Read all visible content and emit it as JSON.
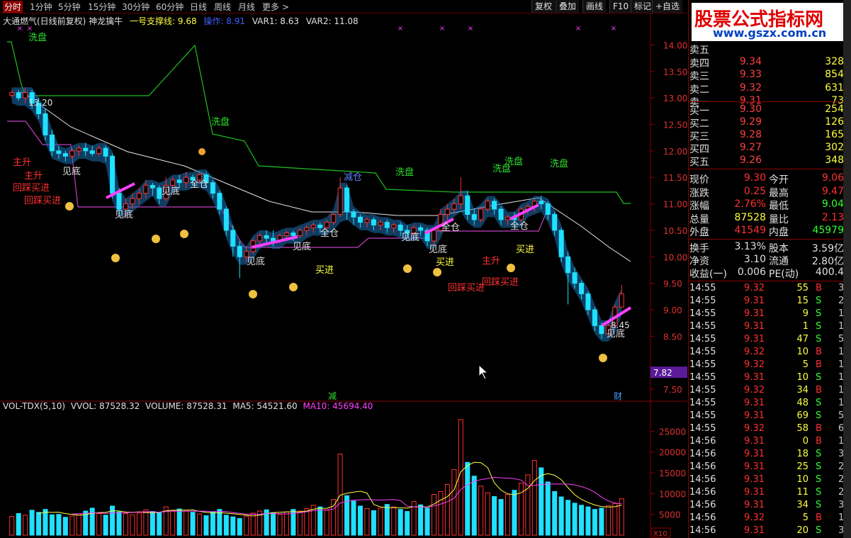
{
  "period_bar": [
    "分时",
    "1分钟",
    "5分钟",
    "15分钟",
    "30分钟",
    "60分钟",
    "日线",
    "周线",
    "月线",
    "更多 >"
  ],
  "toolbar": [
    "复权",
    "叠加",
    "画线",
    "F10",
    "标记",
    "+自选"
  ],
  "indicator_header": {
    "title": "大通燃气(日线前复权) 神龙擒牛",
    "support": "一号支撑线: 9.68",
    "op": "操作: 8.91",
    "var1": "VAR1: 8.63",
    "var2": "VAR2: 11.08"
  },
  "price_axis": [
    "14.00",
    "13.50",
    "13.00",
    "12.50",
    "12.00",
    "11.50",
    "11.00",
    "10.50",
    "10.00",
    "9.50",
    "9.00",
    "8.50",
    "7.82",
    "7.50"
  ],
  "volume_axis": [
    "25000",
    "20000",
    "15000",
    "10000",
    "5000",
    "X10"
  ],
  "volume_header": {
    "name": "VOL-TDX(5,10)",
    "vvol": "VVOL: 87528.32",
    "volume": "VOLUME: 87528.31",
    "ma5": "MA5: 54521.60",
    "ma10": "MA10: 45694.40"
  },
  "chart_labels": {
    "high": "13.20",
    "low": "8.45",
    "xipan": "洗盘",
    "jiandi": "见底",
    "quancang": "全仓",
    "jiancang": "减仓",
    "maijin": "买进",
    "zhusheng": "主升",
    "huicai": "回踩买进",
    "jian": "减",
    "cai": "财"
  },
  "logo": {
    "title": "股票公式指标网",
    "url": "www.gszx.com.cn"
  },
  "order_book": {
    "asks": [
      {
        "label": "卖五",
        "price": "",
        "vol": ""
      },
      {
        "label": "卖四",
        "price": "9.34",
        "vol": "328"
      },
      {
        "label": "卖三",
        "price": "9.33",
        "vol": "854"
      },
      {
        "label": "卖二",
        "price": "9.32",
        "vol": "631"
      },
      {
        "label": "卖一",
        "price": "9.31",
        "vol": "73"
      }
    ],
    "bids": [
      {
        "label": "买一",
        "price": "9.30",
        "vol": "254"
      },
      {
        "label": "买二",
        "price": "9.29",
        "vol": "126"
      },
      {
        "label": "买三",
        "price": "9.28",
        "vol": "165"
      },
      {
        "label": "买四",
        "price": "9.27",
        "vol": "302"
      },
      {
        "label": "买五",
        "price": "9.26",
        "vol": "348"
      }
    ]
  },
  "quote": [
    {
      "l1": "现价",
      "v1": "9.30",
      "c1": "red",
      "l2": "今开",
      "v2": "9.06",
      "c2": "red"
    },
    {
      "l1": "涨跌",
      "v1": "0.25",
      "c1": "red",
      "l2": "最高",
      "v2": "9.47",
      "c2": "red"
    },
    {
      "l1": "涨幅",
      "v1": "2.76%",
      "c1": "red",
      "l2": "最低",
      "v2": "9.04",
      "c2": "grn"
    },
    {
      "l1": "总量",
      "v1": "87528",
      "c1": "yel",
      "l2": "量比",
      "v2": "2.13",
      "c2": "red"
    },
    {
      "l1": "外盘",
      "v1": "41549",
      "c1": "red",
      "l2": "内盘",
      "v2": "45979",
      "c2": "grn"
    }
  ],
  "quote2": [
    {
      "l1": "换手",
      "v1": "3.13%",
      "c1": "wht",
      "l2": "股本",
      "v2": "3.59亿",
      "c2": "wht"
    },
    {
      "l1": "净资",
      "v1": "3.10",
      "c1": "wht",
      "l2": "流通",
      "v2": "2.80亿",
      "c2": "wht"
    },
    {
      "l1": "收益(一)",
      "v1": "0.006",
      "c1": "wht",
      "l2": "PE(动)",
      "v2": "400.4",
      "c2": "wht"
    }
  ],
  "ticks": [
    {
      "t": "14:55",
      "p": "9.32",
      "v": "55",
      "bs": "B",
      "n": "3"
    },
    {
      "t": "14:55",
      "p": "9.31",
      "v": "15",
      "bs": "S",
      "n": "2"
    },
    {
      "t": "14:55",
      "p": "9.31",
      "v": "9",
      "bs": "S",
      "n": "1"
    },
    {
      "t": "14:55",
      "p": "9.31",
      "v": "1",
      "bs": "S",
      "n": "1"
    },
    {
      "t": "14:55",
      "p": "9.31",
      "v": "47",
      "bs": "S",
      "n": "5"
    },
    {
      "t": "14:55",
      "p": "9.32",
      "v": "10",
      "bs": "B",
      "n": "1"
    },
    {
      "t": "14:55",
      "p": "9.32",
      "v": "5",
      "bs": "B",
      "n": "1"
    },
    {
      "t": "14:55",
      "p": "9.31",
      "v": "10",
      "bs": "S",
      "n": "1"
    },
    {
      "t": "14:55",
      "p": "9.32",
      "v": "34",
      "bs": "B",
      "n": "1"
    },
    {
      "t": "14:55",
      "p": "9.31",
      "v": "48",
      "bs": "S",
      "n": "1"
    },
    {
      "t": "14:55",
      "p": "9.31",
      "v": "69",
      "bs": "S",
      "n": "5"
    },
    {
      "t": "14:55",
      "p": "9.32",
      "v": "58",
      "bs": "B",
      "n": "6"
    },
    {
      "t": "14:56",
      "p": "9.31",
      "v": "0",
      "bs": "B",
      "n": "1"
    },
    {
      "t": "14:56",
      "p": "9.31",
      "v": "18",
      "bs": "S",
      "n": "3"
    },
    {
      "t": "14:56",
      "p": "9.31",
      "v": "25",
      "bs": "S",
      "n": "2"
    },
    {
      "t": "14:56",
      "p": "9.31",
      "v": "10",
      "bs": "S",
      "n": "2"
    },
    {
      "t": "14:56",
      "p": "9.31",
      "v": "11",
      "bs": "S",
      "n": "2"
    },
    {
      "t": "14:56",
      "p": "9.31",
      "v": "34",
      "bs": "S",
      "n": "3"
    },
    {
      "t": "14:56",
      "p": "9.32",
      "v": "5",
      "bs": "B",
      "n": "1"
    },
    {
      "t": "14:56",
      "p": "9.31",
      "v": "20",
      "bs": "S",
      "n": "3"
    }
  ],
  "chart_data": {
    "type": "candlestick",
    "price_ylim": [
      7.3,
      14.3
    ],
    "volume_ylim": [
      0,
      30000
    ],
    "candles": [
      [
        13.05,
        13.1,
        13.0,
        13.15
      ],
      [
        13.1,
        13.0,
        12.95,
        13.15
      ],
      [
        13.0,
        13.1,
        12.9,
        13.2
      ],
      [
        13.1,
        12.9,
        12.8,
        13.15
      ],
      [
        12.9,
        12.7,
        12.6,
        13.0
      ],
      [
        12.7,
        12.3,
        12.2,
        12.8
      ],
      [
        12.3,
        12.0,
        11.9,
        12.4
      ],
      [
        12.0,
        11.95,
        11.85,
        12.1
      ],
      [
        11.95,
        11.9,
        11.8,
        12.0
      ],
      [
        11.9,
        12.0,
        11.85,
        12.05
      ],
      [
        12.0,
        12.05,
        11.9,
        12.1
      ],
      [
        12.05,
        12.0,
        11.9,
        12.15
      ],
      [
        12.0,
        11.95,
        11.9,
        12.1
      ],
      [
        11.95,
        12.05,
        11.9,
        12.1
      ],
      [
        12.05,
        11.9,
        11.8,
        12.1
      ],
      [
        11.9,
        11.2,
        11.1,
        11.95
      ],
      [
        11.2,
        10.9,
        10.8,
        11.3
      ],
      [
        10.9,
        11.0,
        10.75,
        11.1
      ],
      [
        11.0,
        11.1,
        10.9,
        11.2
      ],
      [
        11.1,
        11.2,
        11.0,
        11.3
      ],
      [
        11.2,
        11.35,
        11.1,
        11.45
      ],
      [
        11.35,
        11.3,
        11.15,
        11.4
      ],
      [
        11.3,
        11.1,
        11.0,
        11.35
      ],
      [
        11.1,
        11.35,
        11.05,
        11.5
      ],
      [
        11.35,
        11.45,
        11.3,
        11.5
      ],
      [
        11.45,
        11.4,
        11.3,
        11.55
      ],
      [
        11.4,
        11.5,
        11.3,
        11.6
      ],
      [
        11.5,
        11.45,
        11.35,
        11.55
      ],
      [
        11.45,
        11.55,
        11.4,
        11.6
      ],
      [
        11.55,
        11.4,
        11.3,
        11.6
      ],
      [
        11.4,
        11.2,
        11.1,
        11.45
      ],
      [
        11.2,
        10.9,
        10.8,
        11.25
      ],
      [
        10.9,
        10.5,
        10.4,
        10.95
      ],
      [
        10.5,
        10.2,
        10.0,
        10.6
      ],
      [
        10.2,
        10.0,
        9.6,
        10.3
      ],
      [
        10.0,
        10.1,
        9.9,
        10.2
      ],
      [
        10.1,
        10.3,
        10.05,
        10.35
      ],
      [
        10.3,
        10.4,
        10.2,
        10.45
      ],
      [
        10.4,
        10.35,
        10.25,
        10.5
      ],
      [
        10.35,
        10.3,
        10.2,
        10.5
      ],
      [
        10.3,
        10.4,
        10.25,
        10.45
      ],
      [
        10.4,
        10.45,
        10.3,
        10.5
      ],
      [
        10.45,
        10.4,
        10.3,
        10.5
      ],
      [
        10.4,
        10.5,
        10.35,
        10.55
      ],
      [
        10.5,
        10.55,
        10.4,
        10.6
      ],
      [
        10.55,
        10.6,
        10.45,
        10.65
      ],
      [
        10.6,
        10.55,
        10.45,
        10.65
      ],
      [
        10.55,
        10.65,
        10.5,
        10.7
      ],
      [
        10.65,
        10.8,
        10.6,
        10.85
      ],
      [
        10.8,
        11.3,
        10.75,
        11.5
      ],
      [
        11.3,
        10.85,
        10.7,
        11.35
      ],
      [
        10.85,
        10.75,
        10.6,
        10.9
      ],
      [
        10.75,
        10.65,
        10.55,
        10.8
      ],
      [
        10.65,
        10.7,
        10.55,
        10.75
      ],
      [
        10.7,
        10.6,
        10.5,
        10.75
      ],
      [
        10.6,
        10.65,
        10.5,
        10.7
      ],
      [
        10.65,
        10.55,
        10.45,
        10.7
      ],
      [
        10.55,
        10.6,
        10.45,
        10.65
      ],
      [
        10.6,
        10.5,
        10.4,
        10.65
      ],
      [
        10.5,
        10.45,
        10.35,
        10.6
      ],
      [
        10.45,
        10.55,
        10.4,
        10.6
      ],
      [
        10.55,
        10.5,
        10.4,
        10.6
      ],
      [
        10.5,
        10.3,
        10.2,
        10.55
      ],
      [
        10.3,
        10.5,
        10.2,
        10.55
      ],
      [
        10.5,
        10.8,
        10.45,
        10.9
      ],
      [
        10.8,
        10.9,
        10.7,
        11.0
      ],
      [
        10.9,
        11.0,
        10.8,
        11.1
      ],
      [
        11.0,
        11.15,
        10.9,
        11.5
      ],
      [
        11.15,
        10.8,
        10.7,
        11.25
      ],
      [
        10.8,
        10.7,
        10.6,
        10.9
      ],
      [
        10.7,
        10.9,
        10.65,
        10.95
      ],
      [
        10.9,
        11.05,
        10.85,
        11.1
      ],
      [
        11.05,
        10.9,
        10.8,
        11.1
      ],
      [
        10.9,
        10.7,
        10.6,
        10.95
      ],
      [
        10.7,
        10.75,
        10.6,
        10.8
      ],
      [
        10.75,
        10.7,
        10.6,
        10.85
      ],
      [
        10.7,
        10.9,
        10.65,
        10.95
      ],
      [
        10.9,
        10.95,
        10.8,
        11.0
      ],
      [
        10.95,
        11.05,
        10.85,
        11.1
      ],
      [
        11.05,
        11.0,
        10.9,
        11.15
      ],
      [
        11.0,
        10.8,
        10.7,
        11.05
      ],
      [
        10.8,
        10.5,
        10.4,
        10.85
      ],
      [
        10.5,
        10.0,
        9.9,
        10.55
      ],
      [
        10.0,
        9.7,
        9.1,
        10.1
      ],
      [
        9.7,
        9.5,
        9.4,
        9.8
      ],
      [
        9.5,
        9.3,
        9.2,
        9.55
      ],
      [
        9.3,
        9.0,
        8.9,
        9.35
      ],
      [
        9.0,
        8.7,
        8.6,
        9.05
      ],
      [
        8.7,
        8.55,
        8.45,
        8.75
      ],
      [
        8.55,
        8.7,
        8.5,
        8.75
      ],
      [
        8.7,
        9.05,
        8.65,
        9.1
      ],
      [
        9.05,
        9.3,
        9.04,
        9.47
      ]
    ],
    "volumes": [
      4500,
      5200,
      4800,
      6000,
      5500,
      6200,
      4900,
      5000,
      4300,
      4600,
      5100,
      5800,
      6500,
      5200,
      4800,
      7000,
      5600,
      5200,
      4900,
      5300,
      6100,
      5700,
      5400,
      6800,
      5900,
      6300,
      5800,
      5500,
      5100,
      4700,
      5600,
      6200,
      4800,
      4400,
      4000,
      4600,
      5300,
      5800,
      6100,
      5400,
      5000,
      5600,
      6200,
      5800,
      6400,
      7200,
      6800,
      6000,
      8600,
      19500,
      9500,
      8200,
      7000,
      6400,
      5900,
      6500,
      7400,
      6800,
      6200,
      5700,
      8100,
      7300,
      6500,
      9800,
      10500,
      12200,
      15800,
      27800,
      17500,
      14200,
      11800,
      10200,
      9300,
      8600,
      9800,
      10800,
      12500,
      14500,
      18000,
      16200,
      12800,
      10500,
      9200,
      8400,
      7700,
      7200,
      6800,
      6200,
      6500,
      7100,
      7600,
      8752
    ],
    "ma5": [],
    "ma10": []
  }
}
